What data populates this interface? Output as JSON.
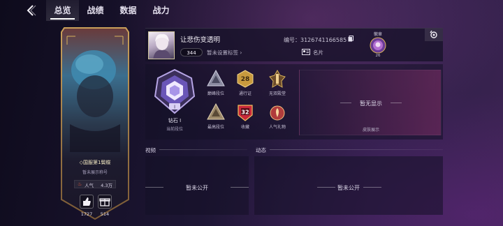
{
  "nav": {
    "tabs": [
      {
        "label": "总览",
        "active": true
      },
      {
        "label": "战绩",
        "active": false
      },
      {
        "label": "数据",
        "active": false
      },
      {
        "label": "战力",
        "active": false
      }
    ]
  },
  "hero_card": {
    "title": "◇国服第1鬓蝶",
    "subtitle": "暂未展示称号",
    "popularity_label": "人气",
    "popularity_value": "4.3万",
    "likes": "1727",
    "gifts": "514"
  },
  "profile": {
    "name": "让悲伤变透明",
    "level": "344",
    "tag_placeholder": "暂未设置标签",
    "id_text": "编号：3126741166585",
    "namecard_label": "名片",
    "crest_title": "徽章",
    "crest_number": "26"
  },
  "rank": {
    "tier_name": "钻石 I",
    "tier_number": "I",
    "caption": "当前段位",
    "badges": [
      {
        "label": "巅峰段位",
        "icon": "peak-rank-icon"
      },
      {
        "label": "通行证",
        "icon": "battle-pass-icon",
        "value": "28"
      },
      {
        "label": "无双殿堂",
        "icon": "hall-icon"
      },
      {
        "label": "最高段位",
        "icon": "highest-rank-icon"
      },
      {
        "label": "收藏",
        "icon": "collection-icon",
        "value": "32"
      },
      {
        "label": "人气礼物",
        "icon": "gift-icon"
      }
    ]
  },
  "skin": {
    "empty_text": "暂无显示",
    "caption": "皮肤展示"
  },
  "sections": {
    "video_label": "视频",
    "dynamic_label": "动态",
    "video_empty": "暂未公开",
    "dynamic_empty": "暂未公开"
  },
  "colors": {
    "accent_gold": "#d8b25a",
    "accent_red": "#c8283a",
    "background": "#1c1532"
  }
}
